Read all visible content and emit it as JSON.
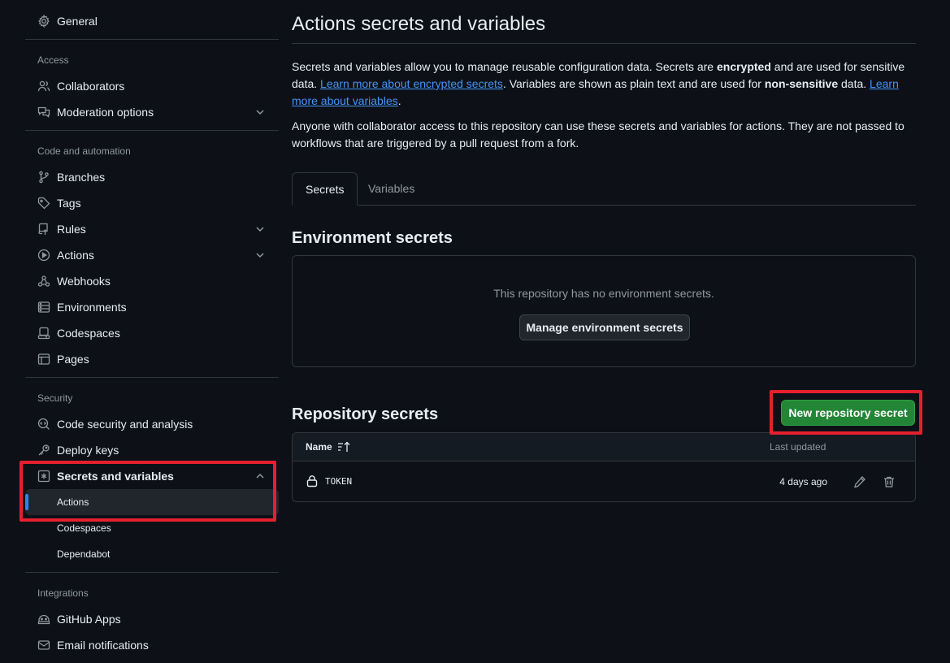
{
  "sidebar": {
    "general": "General",
    "sections": {
      "access": "Access",
      "code_automation": "Code and automation",
      "security": "Security",
      "integrations": "Integrations"
    },
    "items": {
      "collaborators": "Collaborators",
      "moderation": "Moderation options",
      "branches": "Branches",
      "tags": "Tags",
      "rules": "Rules",
      "actions": "Actions",
      "webhooks": "Webhooks",
      "environments": "Environments",
      "codespaces": "Codespaces",
      "pages": "Pages",
      "code_security": "Code security and analysis",
      "deploy_keys": "Deploy keys",
      "secrets_variables": "Secrets and variables",
      "sub_actions": "Actions",
      "sub_codespaces": "Codespaces",
      "sub_dependabot": "Dependabot",
      "github_apps": "GitHub Apps",
      "email_notifications": "Email notifications"
    }
  },
  "main": {
    "title": "Actions secrets and variables",
    "intro": {
      "t1": "Secrets and variables allow you to manage reusable configuration data. Secrets are ",
      "b1": "encrypted",
      "t2": " and are used for sensitive data. ",
      "link1": "Learn more about encrypted secrets",
      "t3": ". Variables are shown as plain text and are used for ",
      "b2": "non-sensitive",
      "t4": " data. ",
      "link2": "Learn more about variables",
      "t5": "."
    },
    "notice": "Anyone with collaborator access to this repository can use these secrets and variables for actions. They are not passed to workflows that are triggered by a pull request from a fork.",
    "tabs": {
      "secrets": "Secrets",
      "variables": "Variables"
    },
    "environment": {
      "heading": "Environment secrets",
      "empty": "This repository has no environment secrets.",
      "manage_button": "Manage environment secrets"
    },
    "repository": {
      "heading": "Repository secrets",
      "new_button": "New repository secret",
      "columns": {
        "name": "Name",
        "updated": "Last updated"
      },
      "rows": [
        {
          "name": "TOKEN",
          "updated": "4 days ago"
        }
      ]
    }
  },
  "colors": {
    "background": "#0d1117",
    "accent_blue": "#2f81f7",
    "primary_green": "#238636",
    "highlight_red": "#e5202e"
  },
  "icons": {
    "general": "gear-icon",
    "collaborators": "people-icon",
    "moderation": "comment-discussion-icon",
    "branches": "git-branch-icon",
    "tags": "tag-icon",
    "rules": "repo-push-icon",
    "actions": "play-icon",
    "webhooks": "webhook-icon",
    "environments": "server-icon",
    "codespaces": "codespaces-icon",
    "pages": "browser-icon",
    "code_security": "codescan-icon",
    "deploy_keys": "key-icon",
    "secrets": "asterisk-icon",
    "github_apps": "apps-icon",
    "email": "mail-icon",
    "lock": "lock-icon",
    "edit": "pencil-icon",
    "delete": "trash-icon",
    "sort": "sort-asc-icon"
  }
}
